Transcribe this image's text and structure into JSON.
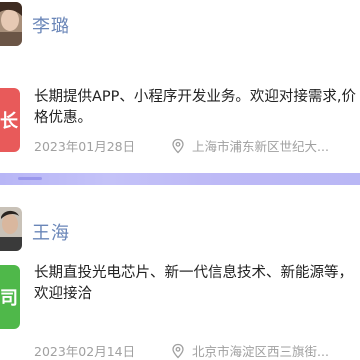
{
  "items": [
    {
      "name": "李璐",
      "thumb_char": "长",
      "thumb_color": "#e85a5a",
      "description": "长期提供APP、小程序开发业务。欢迎对接需求,价格优惠。",
      "date": "2023年01月28日",
      "location": "上海市浦东新区世纪大..."
    },
    {
      "name": "王海",
      "thumb_char": "司",
      "thumb_color": "#4fb84a",
      "description": "长期直投光电芯片、新一代信息技术、新能源等，欢迎接洽",
      "date": "2023年02月14日",
      "location": "北京市海淀区西三旗街..."
    }
  ],
  "icons": {
    "location": "location-pin-icon"
  },
  "colors": {
    "divider": "#b8b6f6",
    "name": "#6a86b8",
    "meta": "#a0a0a0"
  }
}
